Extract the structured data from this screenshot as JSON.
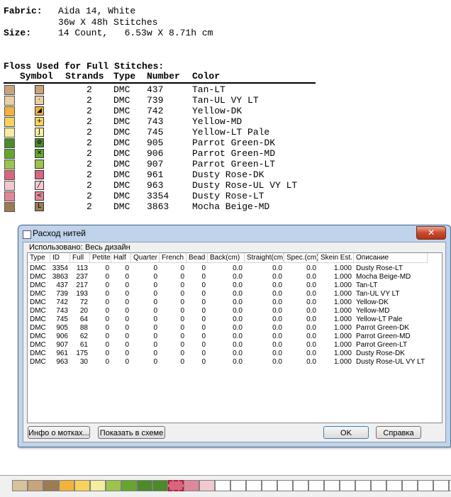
{
  "header": {
    "fabric_label": "Fabric:",
    "fabric_line1": "Aida 14, White",
    "fabric_line2": "36w X 48h Stitches",
    "size_label": "Size:",
    "size_value": "14 Count,   6.53w X 8.71h cm"
  },
  "floss_section": {
    "title": "Floss Used for Full Stitches:",
    "columns": [
      "Symbol",
      "Strands",
      "Type",
      "Number",
      "Color"
    ],
    "rows": [
      {
        "swatch": "#c8a47a",
        "symbol": "",
        "strands": "2",
        "type": "DMC",
        "number": "437",
        "color": "Tan-LT"
      },
      {
        "swatch": "#e9cfa4",
        "symbol": "·",
        "strands": "2",
        "type": "DMC",
        "number": "739",
        "color": "Tan-UL VY LT"
      },
      {
        "swatch": "#f2b33a",
        "symbol": "◢",
        "strands": "2",
        "type": "DMC",
        "number": "742",
        "color": "Yellow-DK"
      },
      {
        "swatch": "#f7d35a",
        "symbol": "+",
        "strands": "2",
        "type": "DMC",
        "number": "743",
        "color": "Yellow-MD"
      },
      {
        "swatch": "#f4ec9e",
        "symbol": "J",
        "strands": "2",
        "type": "DMC",
        "number": "745",
        "color": "Yellow-LT Pale"
      },
      {
        "swatch": "#4c8a2a",
        "symbol": "⊚",
        "strands": "2",
        "type": "DMC",
        "number": "905",
        "color": "Parrot Green-DK"
      },
      {
        "swatch": "#66a62f",
        "symbol": "✕",
        "strands": "2",
        "type": "DMC",
        "number": "906",
        "color": "Parrot Green-MD"
      },
      {
        "swatch": "#9cc44c",
        "symbol": "",
        "strands": "2",
        "type": "DMC",
        "number": "907",
        "color": "Parrot Green-LT"
      },
      {
        "swatch": "#d9657e",
        "symbol": "",
        "strands": "2",
        "type": "DMC",
        "number": "961",
        "color": "Dusty Rose-DK"
      },
      {
        "swatch": "#f3c9d0",
        "symbol": "╱",
        "strands": "2",
        "type": "DMC",
        "number": "963",
        "color": "Dusty Rose-UL VY LT"
      },
      {
        "swatch": "#e0879a",
        "symbol": "<",
        "strands": "2",
        "type": "DMC",
        "number": "3354",
        "color": "Dusty Rose-LT"
      },
      {
        "swatch": "#9c7b55",
        "symbol": "L",
        "strands": "2",
        "type": "DMC",
        "number": "3863",
        "color": "Mocha Beige-MD"
      }
    ]
  },
  "dialog": {
    "title": "Расход нитей",
    "close_label": "✕",
    "used_label": "Использовано:",
    "used_value": "Весь дизайн",
    "columns": [
      "Type",
      "ID",
      "Full",
      "Petite",
      "Half",
      "Quarter",
      "French",
      "Bead",
      "Back(cm)",
      "Straight(cm)",
      "Spec.(cm)",
      "Skein Est.",
      "Описание"
    ],
    "rows": [
      [
        "DMC",
        "3354",
        "113",
        "0",
        "0",
        "0",
        "0",
        "0",
        "0.0",
        "0.0",
        "0.0",
        "1.000",
        "Dusty Rose-LT"
      ],
      [
        "DMC",
        "3863",
        "237",
        "0",
        "0",
        "0",
        "0",
        "0",
        "0.0",
        "0.0",
        "0.0",
        "1.000",
        "Mocha Beige-MD"
      ],
      [
        "DMC",
        "437",
        "217",
        "0",
        "0",
        "0",
        "0",
        "0",
        "0.0",
        "0.0",
        "0.0",
        "1.000",
        "Tan-LT"
      ],
      [
        "DMC",
        "739",
        "193",
        "0",
        "0",
        "0",
        "0",
        "0",
        "0.0",
        "0.0",
        "0.0",
        "1.000",
        "Tan-UL VY LT"
      ],
      [
        "DMC",
        "742",
        "72",
        "0",
        "0",
        "0",
        "0",
        "0",
        "0.0",
        "0.0",
        "0.0",
        "1.000",
        "Yellow-DK"
      ],
      [
        "DMC",
        "743",
        "20",
        "0",
        "0",
        "0",
        "0",
        "0",
        "0.0",
        "0.0",
        "0.0",
        "1.000",
        "Yellow-MD"
      ],
      [
        "DMC",
        "745",
        "64",
        "0",
        "0",
        "0",
        "0",
        "0",
        "0.0",
        "0.0",
        "0.0",
        "1.000",
        "Yellow-LT Pale"
      ],
      [
        "DMC",
        "905",
        "88",
        "0",
        "0",
        "0",
        "0",
        "0",
        "0.0",
        "0.0",
        "0.0",
        "1.000",
        "Parrot Green-DK"
      ],
      [
        "DMC",
        "906",
        "62",
        "0",
        "0",
        "0",
        "0",
        "0",
        "0.0",
        "0.0",
        "0.0",
        "1.000",
        "Parrot Green-MD"
      ],
      [
        "DMC",
        "907",
        "61",
        "0",
        "0",
        "0",
        "0",
        "0",
        "0.0",
        "0.0",
        "0.0",
        "1.000",
        "Parrot Green-LT"
      ],
      [
        "DMC",
        "961",
        "175",
        "0",
        "0",
        "0",
        "0",
        "0",
        "0.0",
        "0.0",
        "0.0",
        "1.000",
        "Dusty Rose-DK"
      ],
      [
        "DMC",
        "963",
        "30",
        "0",
        "0",
        "0",
        "0",
        "0",
        "0.0",
        "0.0",
        "0.0",
        "1.000",
        "Dusty Rose-UL VY LT"
      ]
    ],
    "buttons": {
      "skein_info": "Инфо о мотках...",
      "show_in_chart": "Показать в схеме",
      "ok": "OK",
      "help": "Справка"
    }
  },
  "palette": {
    "colors": [
      "#d6c39b",
      "#c8a47a",
      "#9c7b55",
      "#f2b33a",
      "#f7d35a",
      "#f4ec9e",
      "#9cc44c",
      "#66a62f",
      "#4c8a2a",
      "#4c8a2a",
      "#d9657e",
      "#e0879a",
      "#f3c9d0",
      "#ffffff",
      "#ffffff",
      "#ffffff",
      "#ffffff",
      "#ffffff",
      "#ffffff",
      "#ffffff",
      "#ffffff",
      "#ffffff",
      "#ffffff",
      "#ffffff",
      "#ffffff",
      "#ffffff",
      "#ffffff",
      "#ffffff",
      "#ffffff"
    ]
  }
}
